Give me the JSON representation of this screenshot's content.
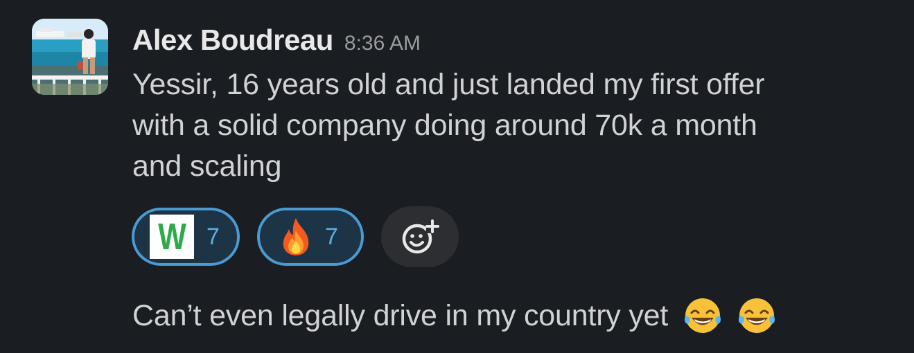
{
  "message": {
    "author": "Alex Boudreau",
    "timestamp": "8:36 AM",
    "text": "Yessir, 16 years old and just landed my first offer\nwith a solid company doing around 70k a month\nand scaling",
    "avatar_icon": "user-photo-avatar"
  },
  "reactions": [
    {
      "emoji_name": "w-letter-emoji",
      "emoji_text": "W",
      "count": "7",
      "accent": "#2eaa4a"
    },
    {
      "emoji_name": "fire-emoji",
      "count": "7"
    }
  ],
  "add_reaction": {
    "icon": "add-reaction-icon"
  },
  "followup": {
    "text": "Can’t even legally drive in my country yet",
    "emojis": [
      "laughing-tears-emoji",
      "laughing-tears-emoji"
    ]
  },
  "colors": {
    "background": "#1a1d21",
    "reaction_border": "#4a9bd1",
    "reaction_bg": "#1d3346",
    "text": "#d1d2d3"
  }
}
